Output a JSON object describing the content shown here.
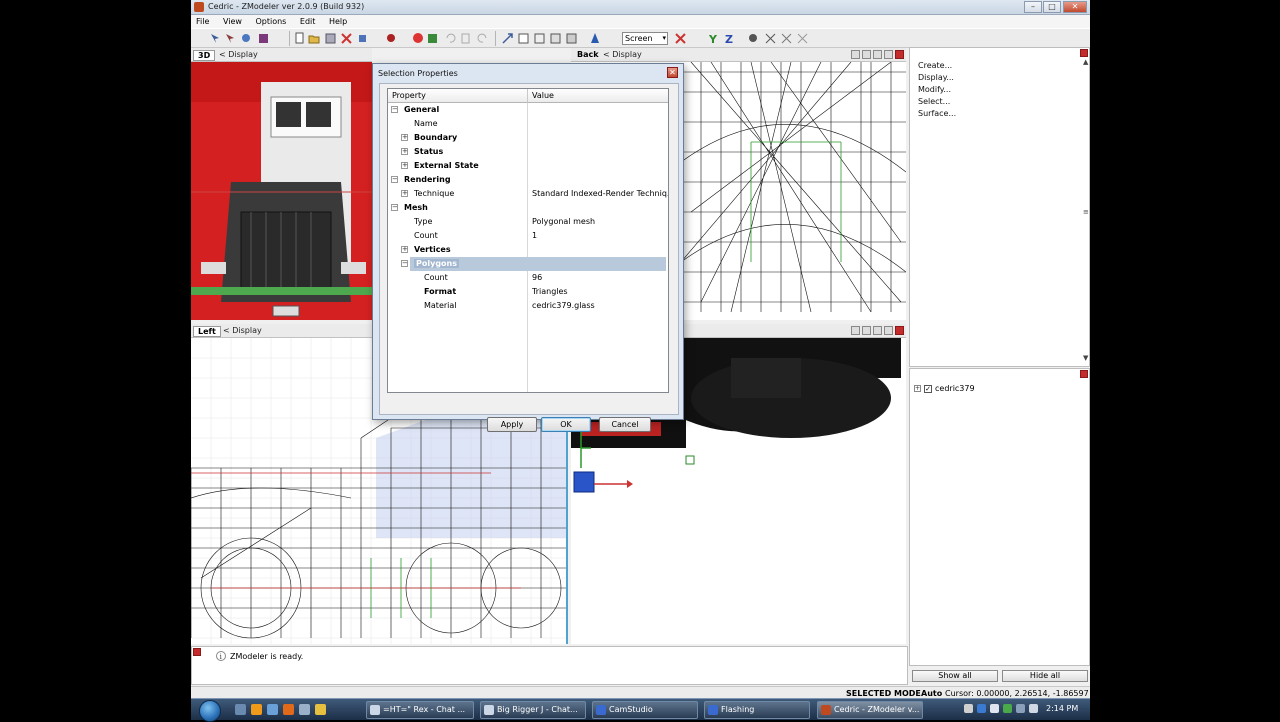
{
  "window": {
    "title": "Cedric - ZModeler ver 2.0.9 (Build 932)"
  },
  "menubar": [
    "File",
    "View",
    "Options",
    "Edit",
    "Help"
  ],
  "toolbar": {
    "screen_select": "Screen"
  },
  "viewports": {
    "top_left": {
      "name": "3D",
      "display": "Display"
    },
    "top_right": {
      "name": "Back",
      "display": "Display"
    },
    "bottom_left": {
      "name": "Left",
      "display": "Display"
    }
  },
  "command_panel": {
    "items": [
      "Create...",
      "Display...",
      "Modify...",
      "Select...",
      "Surface..."
    ]
  },
  "object_tree": {
    "items": [
      {
        "label": "cedric379",
        "checked": true
      }
    ],
    "show_all": "Show all",
    "hide_all": "Hide all"
  },
  "log": {
    "message": "ZModeler is ready."
  },
  "statusbar": {
    "mode": "SELECTED MODE",
    "auto": "Auto",
    "cursor": "Cursor: 0.00000, 2.26514, -1.86597"
  },
  "dialog": {
    "title": "Selection Properties",
    "col_property": "Property",
    "col_value": "Value",
    "rows": [
      {
        "key": "General",
        "value": "",
        "level": 0,
        "expander": "−",
        "bold": true
      },
      {
        "key": "Name",
        "value": "",
        "level": 1,
        "expander": "",
        "bold": false
      },
      {
        "key": "Boundary",
        "value": "",
        "level": 1,
        "expander": "+",
        "bold": true
      },
      {
        "key": "Status",
        "value": "",
        "level": 1,
        "expander": "+",
        "bold": true
      },
      {
        "key": "External State",
        "value": "",
        "level": 1,
        "expander": "+",
        "bold": true
      },
      {
        "key": "Rendering",
        "value": "",
        "level": 0,
        "expander": "−",
        "bold": true
      },
      {
        "key": "Technique",
        "value": "Standard Indexed-Render Techniq...",
        "level": 1,
        "expander": "+",
        "bold": false
      },
      {
        "key": "Mesh",
        "value": "",
        "level": 0,
        "expander": "−",
        "bold": true
      },
      {
        "key": "Type",
        "value": "Polygonal mesh",
        "level": 1,
        "expander": "",
        "bold": false
      },
      {
        "key": "Count",
        "value": "1",
        "level": 1,
        "expander": "",
        "bold": false
      },
      {
        "key": "Vertices",
        "value": "",
        "level": 1,
        "expander": "+",
        "bold": true
      },
      {
        "key": "Polygons",
        "value": "",
        "level": 1,
        "expander": "−",
        "bold": true,
        "selected": true
      },
      {
        "key": "Count",
        "value": "96",
        "level": 2,
        "expander": "",
        "bold": false
      },
      {
        "key": "Format",
        "value": "Triangles",
        "level": 2,
        "expander": "",
        "bold": true
      },
      {
        "key": "Material",
        "value": "cedric379.glass",
        "level": 2,
        "expander": "",
        "bold": false
      }
    ],
    "buttons": {
      "apply": "Apply",
      "ok": "OK",
      "cancel": "Cancel"
    }
  },
  "taskbar": {
    "tasks": [
      "=HT=\" Rex - Chat ...",
      "Big Rigger J - Chat...",
      "CamStudio",
      "Flashing",
      "Cedric - ZModeler v..."
    ],
    "clock": "2:14 PM"
  }
}
